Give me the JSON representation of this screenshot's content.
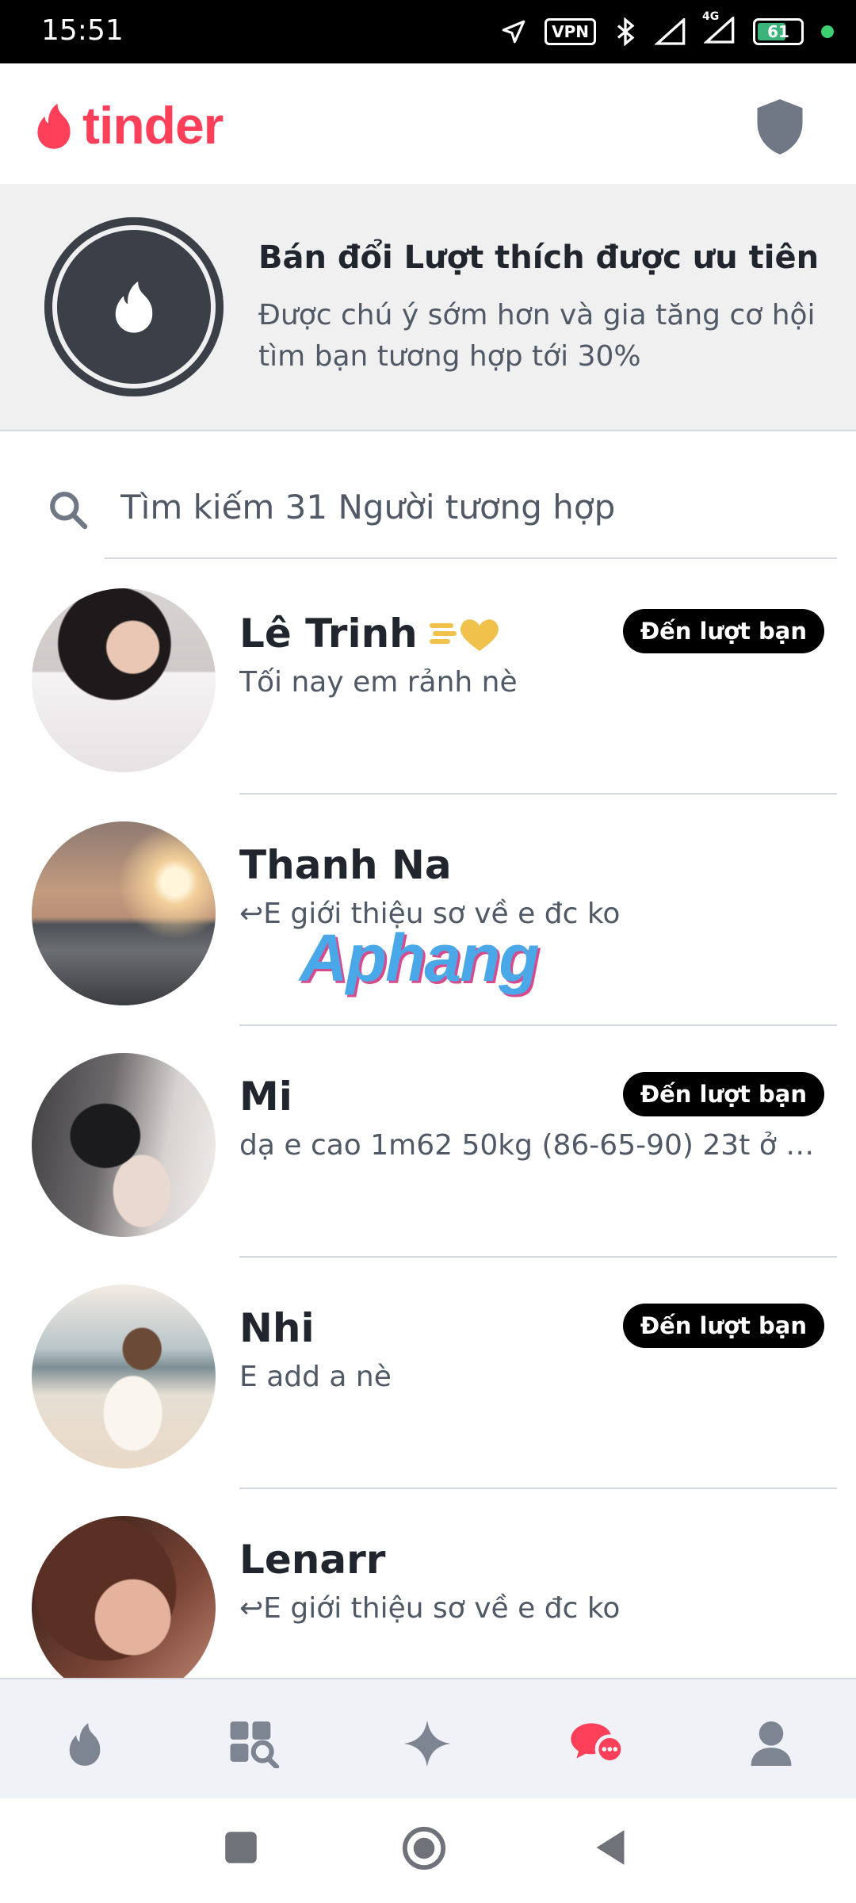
{
  "status_bar": {
    "time": "15:51",
    "vpn_label": "VPN",
    "battery": "61",
    "network": "4G"
  },
  "header": {
    "logo_text": "tinder"
  },
  "promo": {
    "title": "Bán đổi Lượt thích được ưu tiên",
    "subtitle": "Được chú ý sớm hơn và gia tăng cơ hội tìm bạn tương hợp tới 30%"
  },
  "search": {
    "placeholder": "Tìm kiếm 31 Người tương hợp"
  },
  "matches": [
    {
      "name": "Lê Trinh",
      "message": "Tối nay em rảnh nè",
      "badge": "Đến lượt bạn",
      "super_like": true
    },
    {
      "name": "Thanh Na",
      "message": "↩E giới thiệu sơ về e đc ko",
      "badge": ""
    },
    {
      "name": "Mi",
      "message": "dạ e cao 1m62 50kg (86-65-90) 23t ở q...",
      "badge": "Đến lượt bạn"
    },
    {
      "name": "Nhi",
      "message": "E add a nè",
      "badge": "Đến lượt bạn"
    },
    {
      "name": "Lenarr",
      "message": "↩E giới thiệu sơ về e đc ko",
      "badge": ""
    }
  ],
  "watermark": "Aphang",
  "tabs": [
    {
      "icon": "flame-icon",
      "active": false
    },
    {
      "icon": "explore-icon",
      "active": false
    },
    {
      "icon": "sparkle-icon",
      "active": false
    },
    {
      "icon": "chat-icon",
      "active": true
    },
    {
      "icon": "profile-icon",
      "active": false
    }
  ],
  "colors": {
    "brand": "#fd3f5a",
    "text": "#21262e",
    "muted": "#505965",
    "icon_gray": "#7c8591"
  }
}
